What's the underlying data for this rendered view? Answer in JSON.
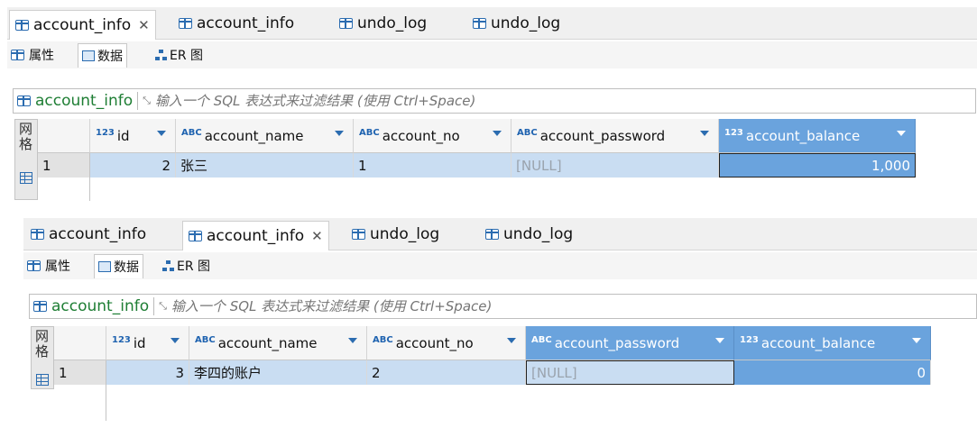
{
  "windows": [
    {
      "tabs": [
        {
          "label": "account_info",
          "active": true,
          "closable": true
        },
        {
          "label": "account_info",
          "active": false,
          "closable": false
        },
        {
          "label": "undo_log",
          "active": false,
          "closable": false
        },
        {
          "label": "undo_log",
          "active": false,
          "closable": false
        }
      ],
      "subtabs": [
        {
          "label": "属性",
          "icon": "table-icon"
        },
        {
          "label": "数据",
          "icon": "data-icon",
          "active": true
        },
        {
          "label": "ER 图",
          "icon": "er-diagram-icon"
        }
      ],
      "filter": {
        "table": "account_info",
        "placeholder": "输入一个 SQL 表达式来过滤结果 (使用 Ctrl+Space)"
      },
      "sidebar_label": "网格",
      "columns": [
        {
          "type": "123",
          "name": "id"
        },
        {
          "type": "ABC",
          "name": "account_name"
        },
        {
          "type": "ABC",
          "name": "account_no"
        },
        {
          "type": "ABC",
          "name": "account_password"
        },
        {
          "type": "123",
          "name": "account_balance"
        }
      ],
      "rows": [
        {
          "num": "1",
          "id": "2",
          "account_name": "张三",
          "account_no": "1",
          "account_password": "[NULL]",
          "account_balance": "1,000"
        }
      ]
    },
    {
      "tabs": [
        {
          "label": "account_info",
          "active": false,
          "closable": false
        },
        {
          "label": "account_info",
          "active": true,
          "closable": true
        },
        {
          "label": "undo_log",
          "active": false,
          "closable": false
        },
        {
          "label": "undo_log",
          "active": false,
          "closable": false
        }
      ],
      "subtabs": [
        {
          "label": "属性",
          "icon": "table-icon"
        },
        {
          "label": "数据",
          "icon": "data-icon",
          "active": true
        },
        {
          "label": "ER 图",
          "icon": "er-diagram-icon"
        }
      ],
      "filter": {
        "table": "account_info",
        "placeholder": "输入一个 SQL 表达式来过滤结果 (使用 Ctrl+Space)"
      },
      "sidebar_label": "网格",
      "columns": [
        {
          "type": "123",
          "name": "id"
        },
        {
          "type": "ABC",
          "name": "account_name"
        },
        {
          "type": "ABC",
          "name": "account_no"
        },
        {
          "type": "ABC",
          "name": "account_password"
        },
        {
          "type": "123",
          "name": "account_balance"
        }
      ],
      "rows": [
        {
          "num": "1",
          "id": "3",
          "account_name": "李四的账户",
          "account_no": "2",
          "account_password": "[NULL]",
          "account_balance": "0"
        }
      ]
    }
  ],
  "colors": {
    "selected_column": "#6aa3dd",
    "row_highlight": "#c9ddf2",
    "accent": "#2b6cb0"
  }
}
